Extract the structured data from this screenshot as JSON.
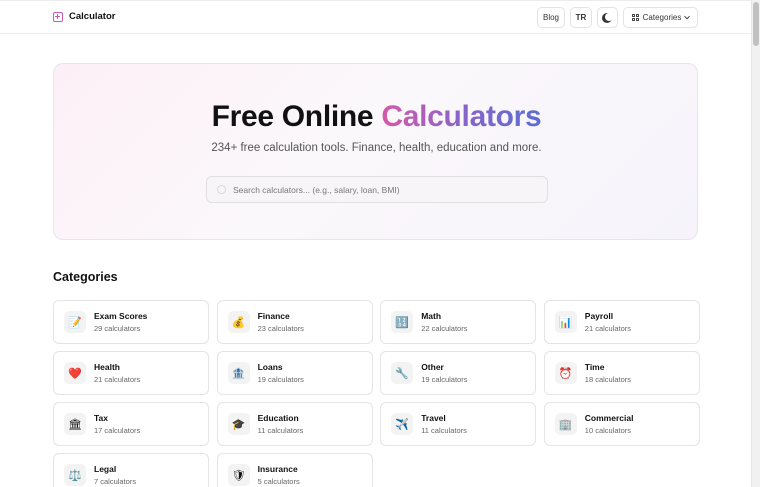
{
  "header": {
    "brand": "Calculator",
    "blog_label": "Blog",
    "lang_label": "TR",
    "categories_label": "Categories"
  },
  "hero": {
    "title_main": "Free Online ",
    "title_accent": "Calculators",
    "subtitle": "234+ free calculation tools. Finance, health, education and more.",
    "search_placeholder": "Search calculators... (e.g., salary, loan, BMI)",
    "search_value": ""
  },
  "categories": {
    "heading": "Categories",
    "items": [
      {
        "name": "Exam Scores",
        "count": "29 calculators",
        "icon": "📝",
        "icon_name": "pencil-icon"
      },
      {
        "name": "Finance",
        "count": "23 calculators",
        "icon": "💰",
        "icon_name": "money-bag-icon"
      },
      {
        "name": "Math",
        "count": "22 calculators",
        "icon": "🔢",
        "icon_name": "numbers-icon"
      },
      {
        "name": "Payroll",
        "count": "21 calculators",
        "icon": "📊",
        "icon_name": "bar-chart-icon"
      },
      {
        "name": "Health",
        "count": "21 calculators",
        "icon": "❤️",
        "icon_name": "heart-icon"
      },
      {
        "name": "Loans",
        "count": "19 calculators",
        "icon": "🏦",
        "icon_name": "bank-icon"
      },
      {
        "name": "Other",
        "count": "19 calculators",
        "icon": "🔧",
        "icon_name": "wrench-icon"
      },
      {
        "name": "Time",
        "count": "18 calculators",
        "icon": "⏰",
        "icon_name": "alarm-clock-icon"
      },
      {
        "name": "Tax",
        "count": "17 calculators",
        "icon": "🏛",
        "icon_name": "government-icon"
      },
      {
        "name": "Education",
        "count": "11 calculators",
        "icon": "🎓",
        "icon_name": "graduation-cap-icon"
      },
      {
        "name": "Travel",
        "count": "11 calculators",
        "icon": "✈️",
        "icon_name": "airplane-icon"
      },
      {
        "name": "Commercial",
        "count": "10 calculators",
        "icon": "🏢",
        "icon_name": "office-building-icon"
      },
      {
        "name": "Legal",
        "count": "7 calculators",
        "icon": "⚖️",
        "icon_name": "scales-icon"
      },
      {
        "name": "Insurance",
        "count": "5 calculators",
        "icon": "🛡",
        "icon_name": "shield-icon"
      }
    ]
  },
  "colors": {
    "accent_pink": "#d65aa8",
    "accent_purple": "#8a63c9",
    "accent_blue": "#5a6fd0"
  }
}
